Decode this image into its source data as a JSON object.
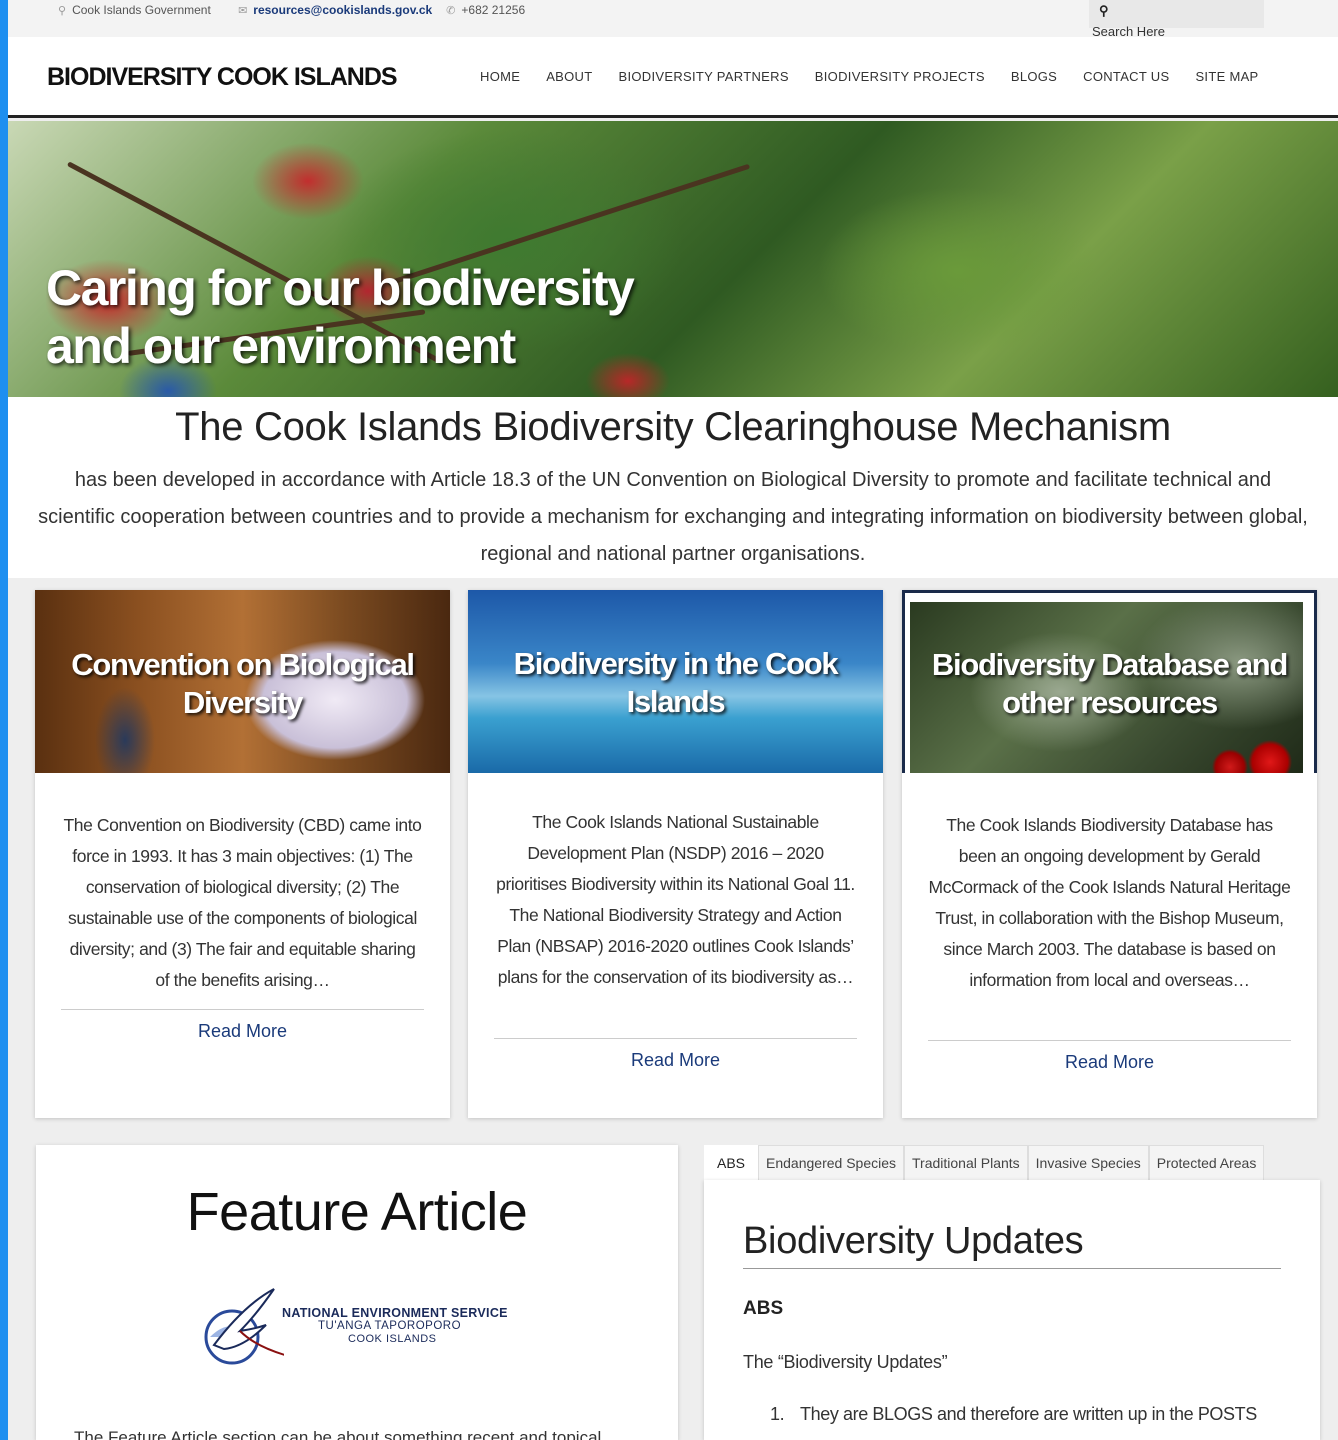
{
  "topbar": {
    "government": "Cook Islands Government",
    "email": "resources@cookislands.gov.ck",
    "phone": "+682 21256",
    "search_placeholder": "Search Here"
  },
  "header": {
    "brand": "BIODIVERSITY COOK ISLANDS",
    "nav": [
      "HOME",
      "ABOUT",
      "BIODIVERSITY PARTNERS",
      "BIODIVERSITY PROJECTS",
      "BLOGS",
      "CONTACT US",
      "SITE MAP"
    ]
  },
  "hero": {
    "title": "Caring for our biodiversity and our environment"
  },
  "intro": {
    "heading": "The Cook Islands Biodiversity Clearinghouse Mechanism",
    "text": "has been developed in accordance with Article 18.3 of the UN Convention on Biological Diversity to promote and facilitate technical and scientific cooperation between countries and to provide a mechanism for exchanging and integrating information on biodiversity between global, regional and national partner organisations."
  },
  "cards": [
    {
      "title": "Convention on Biological Diversity",
      "body": "The Convention on Biodiversity (CBD) came into force in 1993. It has 3 main objectives: (1) The conservation of biological diversity; (2) The sustainable use of the components of biological diversity; and (3) The fair and equitable sharing of the benefits arising…",
      "read_more": "Read More"
    },
    {
      "title": "Biodiversity in the Cook Islands",
      "body": "The Cook Islands National Sustainable Development Plan (NSDP) 2016 – 2020 prioritises Biodiversity within its National Goal 11.  The National Biodiversity Strategy and Action Plan (NBSAP) 2016-2020 outlines Cook Islands’ plans for the conservation of its biodiversity  as…",
      "read_more": "Read More"
    },
    {
      "title": "Biodiversity Database and other resources",
      "body": "The Cook Islands Biodiversity Database has been an ongoing development by Gerald McCormack of the Cook Islands Natural Heritage Trust, in collaboration with the Bishop Museum, since March 2003.  The database is based on information from local and overseas…",
      "read_more": "Read More"
    }
  ],
  "feature": {
    "title": "Feature Article",
    "logo_line1": "NATIONAL ENVIRONMENT SERVICE",
    "logo_line2": "TU'ANGA TAPOROPORO",
    "logo_line3": "COOK ISLANDS",
    "excerpt": "The Feature Article section can be about something recent and topical"
  },
  "tabs": [
    "ABS",
    "Endangered Species",
    "Traditional Plants",
    "Invasive Species",
    "Protected Areas"
  ],
  "updates": {
    "title": "Biodiversity Updates",
    "subtitle": "ABS",
    "lead": "The “Biodiversity Updates”",
    "item_number": "1.",
    "item_text": "They are BLOGS and therefore are written up in the POSTS"
  },
  "colors": {
    "accent_strip": "#1e8ff0",
    "link": "#1a3a7a"
  }
}
